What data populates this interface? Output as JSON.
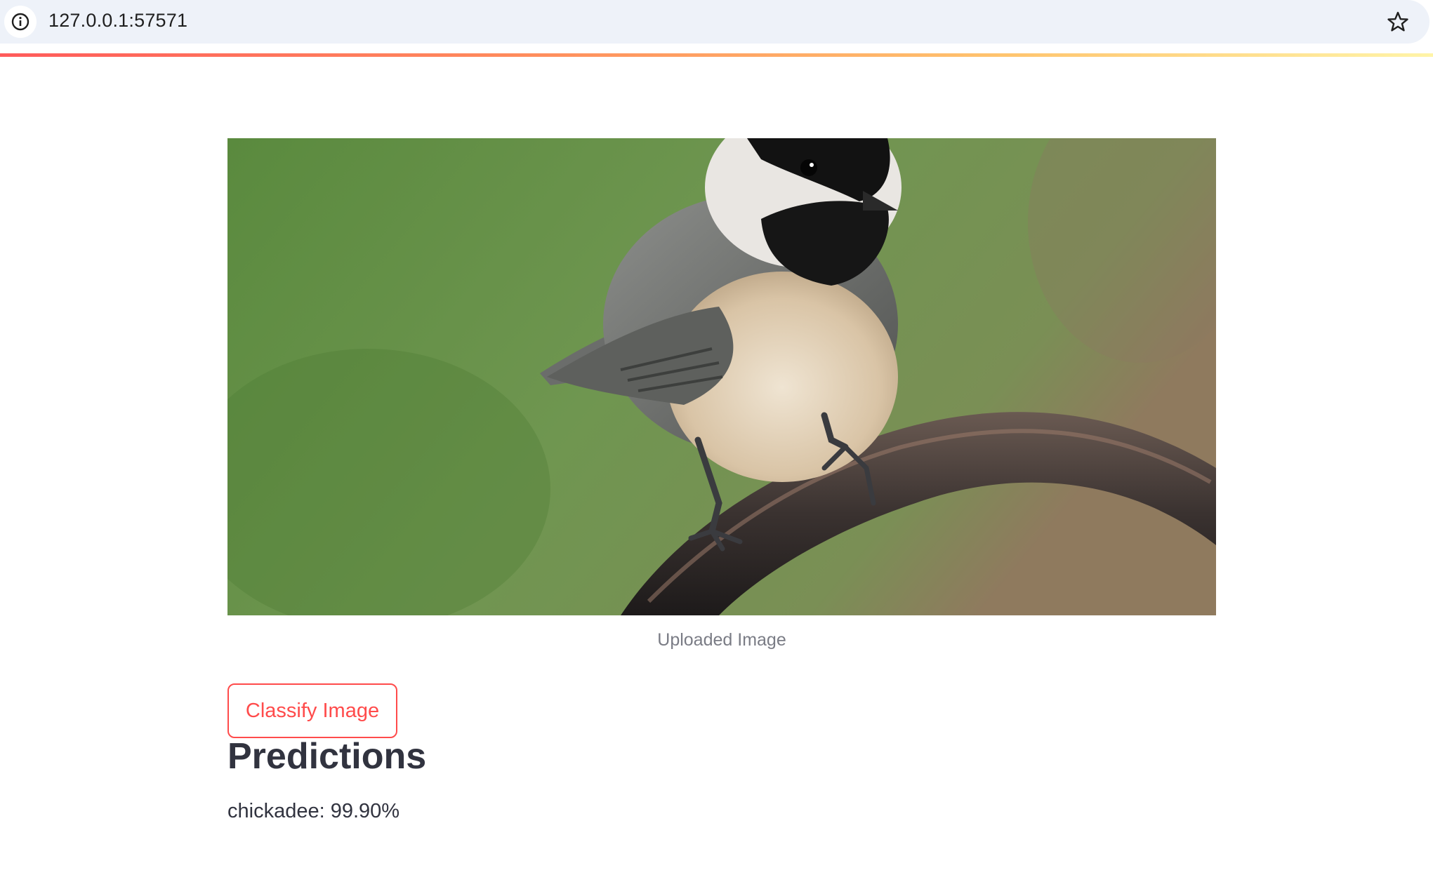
{
  "browser": {
    "url": "127.0.0.1:57571",
    "site_info_icon": "info-icon",
    "bookmark_icon": "star-icon"
  },
  "image": {
    "caption": "Uploaded Image"
  },
  "actions": {
    "classify_label": "Classify Image"
  },
  "results": {
    "heading": "Predictions",
    "items": [
      "chickadee: 99.90%"
    ]
  },
  "colors": {
    "accent": "#ff4b4b",
    "text": "#31333f",
    "caption": "#7a7c85",
    "omnibox": "#eef2f9"
  }
}
